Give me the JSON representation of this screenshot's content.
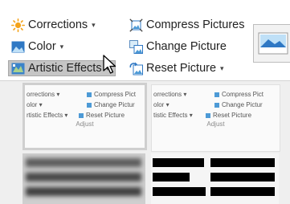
{
  "ribbon": {
    "corrections_label": "Corrections",
    "color_label": "Color",
    "artistic_effects_label": "Artistic Effects",
    "compress_pictures_label": "Compress Pictures",
    "change_picture_label": "Change Picture",
    "reset_picture_label": "Reset Picture",
    "dropdown_caret": "▾",
    "hovered_item": "artistic-effects"
  },
  "gallery": {
    "thumb1": {
      "corrections": "orrections ▾",
      "color": "olor ▾",
      "artistic": "rtistic Effects ▾",
      "compress": "Compress Pict",
      "change": "Change Pictur",
      "reset": "Reset Picture",
      "group": "Adjust"
    },
    "thumb2": {
      "corrections": "orrections ▾",
      "color": "olor ▾",
      "artistic": "tistic Effects ▾",
      "compress": "Compress Pict",
      "change": "Change Pictur",
      "reset": "Reset Picture",
      "group": "Adjust"
    }
  },
  "colors": {
    "ribbon_bg": "#ffffff",
    "gallery_bg": "#efefef",
    "hover_bg": "#c5c5c5",
    "text": "#222222"
  }
}
